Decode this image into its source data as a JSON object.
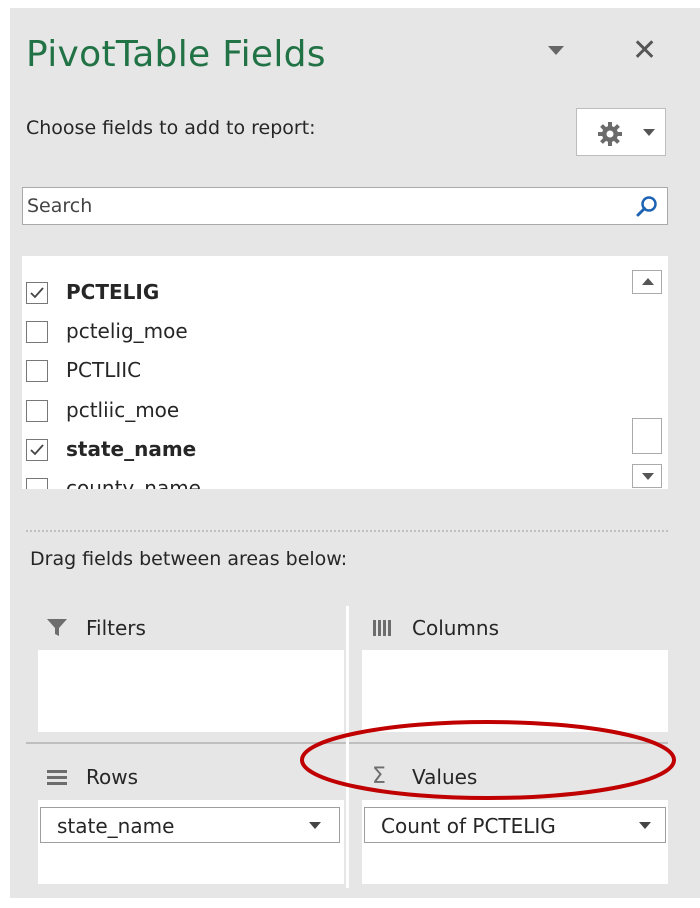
{
  "header": {
    "title": "PivotTable Fields",
    "subtitle": "Choose fields to add to report:"
  },
  "search": {
    "placeholder": "Search"
  },
  "fields": [
    {
      "label": "PCTELIG",
      "checked": true,
      "bold": true
    },
    {
      "label": "pctelig_moe",
      "checked": false,
      "bold": false
    },
    {
      "label": "PCTLIIC",
      "checked": false,
      "bold": false
    },
    {
      "label": "pctliic_moe",
      "checked": false,
      "bold": false
    },
    {
      "label": "state_name",
      "checked": true,
      "bold": true
    },
    {
      "label": "county_name",
      "checked": false,
      "bold": false
    }
  ],
  "areas": {
    "hint": "Drag fields between areas below:",
    "filters": {
      "label": "Filters"
    },
    "columns": {
      "label": "Columns"
    },
    "rows": {
      "label": "Rows",
      "item": "state_name"
    },
    "values": {
      "label": "Values",
      "item": "Count of PCTELIG"
    }
  },
  "colors": {
    "title": "#217346",
    "annotation": "#c00000",
    "panel_bg": "#e6e6e6"
  }
}
